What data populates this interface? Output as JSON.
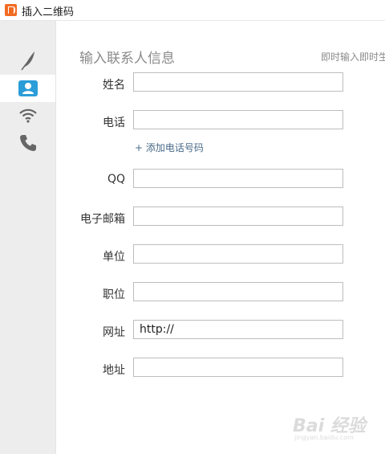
{
  "window": {
    "title": "插入二维码"
  },
  "sidebar": {
    "items": [
      {
        "icon": "feather-icon",
        "label": "",
        "active": false
      },
      {
        "icon": "contact-card-icon",
        "label": "",
        "active": true
      },
      {
        "icon": "wifi-icon",
        "label": "",
        "active": false
      },
      {
        "icon": "phone-icon",
        "label": "",
        "active": false
      }
    ]
  },
  "form": {
    "title": "输入联系人信息",
    "hint": "即时输入即时生",
    "fields": [
      {
        "label": "姓名",
        "value": ""
      },
      {
        "label": "电话",
        "value": ""
      },
      {
        "label": "QQ",
        "value": ""
      },
      {
        "label": "电子邮箱",
        "value": ""
      },
      {
        "label": "单位",
        "value": ""
      },
      {
        "label": "职位",
        "value": ""
      },
      {
        "label": "网址",
        "value": "http://"
      },
      {
        "label": "地址",
        "value": ""
      }
    ],
    "add_phone_label": "+ 添加电话号码"
  },
  "watermark": {
    "main": "Bai 经验",
    "sub": "jingyan.baidu.com"
  },
  "colors": {
    "accent": "#2b9dd8",
    "app_icon": "#f26b21",
    "sidebar_bg": "#ededed"
  }
}
